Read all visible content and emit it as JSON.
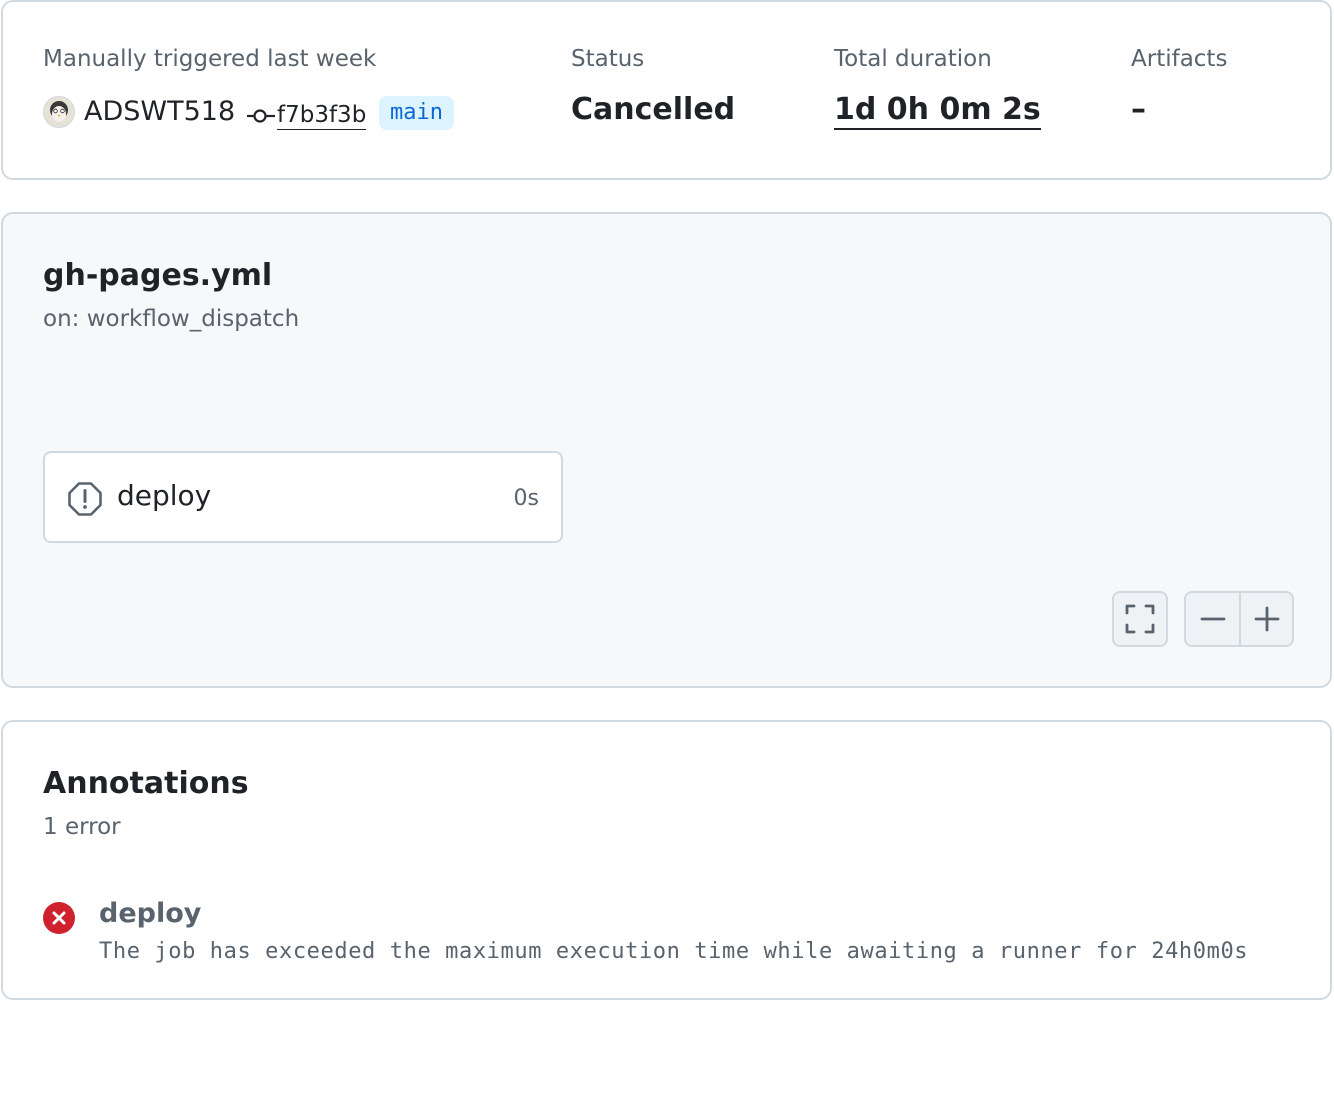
{
  "summary": {
    "trigger_label": "Manually triggered last week",
    "actor": "ADSWT518",
    "commit_sha": "f7b3f3b",
    "branch": "main",
    "status_label": "Status",
    "status_value": "Cancelled",
    "duration_label": "Total duration",
    "duration_value": "1d 0h 0m 2s",
    "artifacts_label": "Artifacts",
    "artifacts_value": "–"
  },
  "workflow": {
    "file": "gh-pages.yml",
    "trigger": "on: workflow_dispatch",
    "jobs": [
      {
        "name": "deploy",
        "duration": "0s",
        "status_icon": "alert-octagon-icon"
      }
    ],
    "controls": [
      "fullscreen-icon",
      "zoom-out-icon",
      "zoom-in-icon"
    ]
  },
  "annotations": {
    "title": "Annotations",
    "count": "1 error",
    "items": [
      {
        "job": "deploy",
        "message": "The job has exceeded the maximum execution time while awaiting a runner for 24h0m0s",
        "icon": "x-circle-fill-icon"
      }
    ]
  },
  "colors": {
    "border": "#d1d9e0",
    "muted_text": "#59636e",
    "branch_bg": "#ddf4ff",
    "branch_text": "#0969da",
    "error": "#cf222e",
    "graph_bg": "#f6f8fa"
  }
}
